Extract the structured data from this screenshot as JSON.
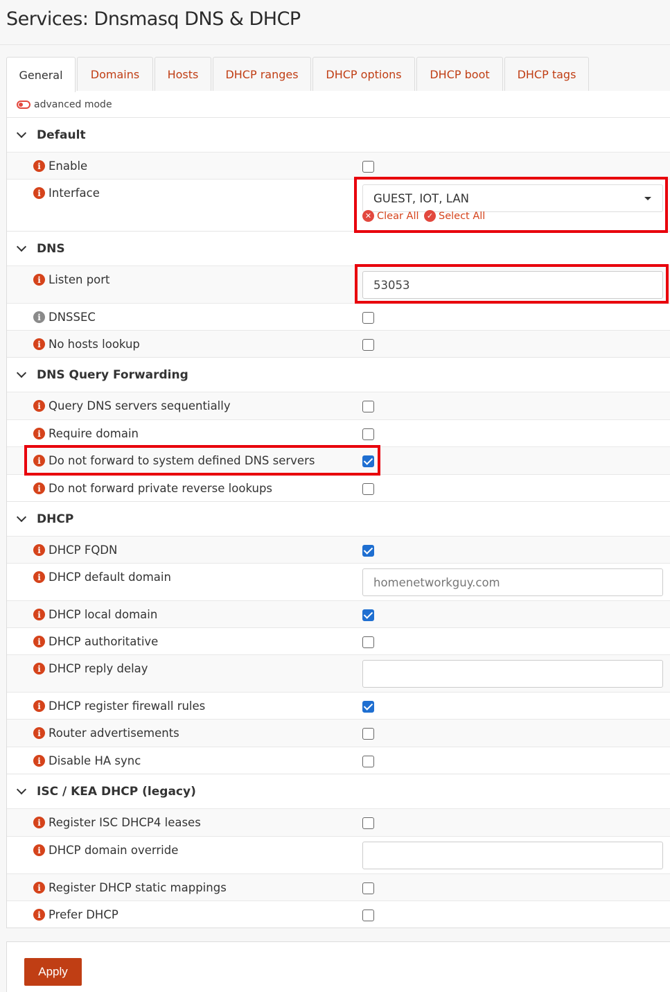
{
  "page": {
    "title": "Services: Dnsmasq DNS & DHCP"
  },
  "tabs": [
    {
      "label": "General",
      "active": true
    },
    {
      "label": "Domains"
    },
    {
      "label": "Hosts"
    },
    {
      "label": "DHCP ranges"
    },
    {
      "label": "DHCP options"
    },
    {
      "label": "DHCP boot"
    },
    {
      "label": "DHCP tags"
    }
  ],
  "advanced_mode": {
    "label": "advanced mode",
    "enabled": false
  },
  "sections": {
    "default": {
      "title": "Default",
      "enable": {
        "label": "Enable",
        "checked": false
      },
      "interface": {
        "label": "Interface",
        "value": "GUEST, IOT, LAN",
        "clear_all": "Clear All",
        "select_all": "Select All"
      }
    },
    "dns": {
      "title": "DNS",
      "listen_port": {
        "label": "Listen port",
        "value": "53053"
      },
      "dnssec": {
        "label": "DNSSEC",
        "checked": false
      },
      "no_hosts": {
        "label": "No hosts lookup",
        "checked": false
      }
    },
    "forwarding": {
      "title": "DNS Query Forwarding",
      "sequential": {
        "label": "Query DNS servers sequentially",
        "checked": false
      },
      "require_domain": {
        "label": "Require domain",
        "checked": false
      },
      "no_system_dns": {
        "label": "Do not forward to system defined DNS servers",
        "checked": true
      },
      "no_private_reverse": {
        "label": "Do not forward private reverse lookups",
        "checked": false
      }
    },
    "dhcp": {
      "title": "DHCP",
      "fqdn": {
        "label": "DHCP FQDN",
        "checked": true
      },
      "default_domain": {
        "label": "DHCP default domain",
        "placeholder": "homenetworkguy.com"
      },
      "local_domain": {
        "label": "DHCP local domain",
        "checked": true
      },
      "authoritative": {
        "label": "DHCP authoritative",
        "checked": false
      },
      "reply_delay": {
        "label": "DHCP reply delay",
        "value": ""
      },
      "firewall_rules": {
        "label": "DHCP register firewall rules",
        "checked": true
      },
      "router_adv": {
        "label": "Router advertisements",
        "checked": false
      },
      "ha_sync": {
        "label": "Disable HA sync",
        "checked": false
      }
    },
    "isc": {
      "title": "ISC / KEA DHCP (legacy)",
      "register_leases": {
        "label": "Register ISC DHCP4 leases",
        "checked": false
      },
      "domain_override": {
        "label": "DHCP domain override",
        "value": ""
      },
      "static_mappings": {
        "label": "Register DHCP static mappings",
        "checked": false
      },
      "prefer_dhcp": {
        "label": "Prefer DHCP",
        "checked": false
      }
    }
  },
  "apply_button": {
    "label": "Apply"
  },
  "colors": {
    "accent": "#c03e14",
    "info_icon": "#d5431b",
    "highlight": "#e8000c",
    "checkbox_checked": "#1f6fd1"
  }
}
